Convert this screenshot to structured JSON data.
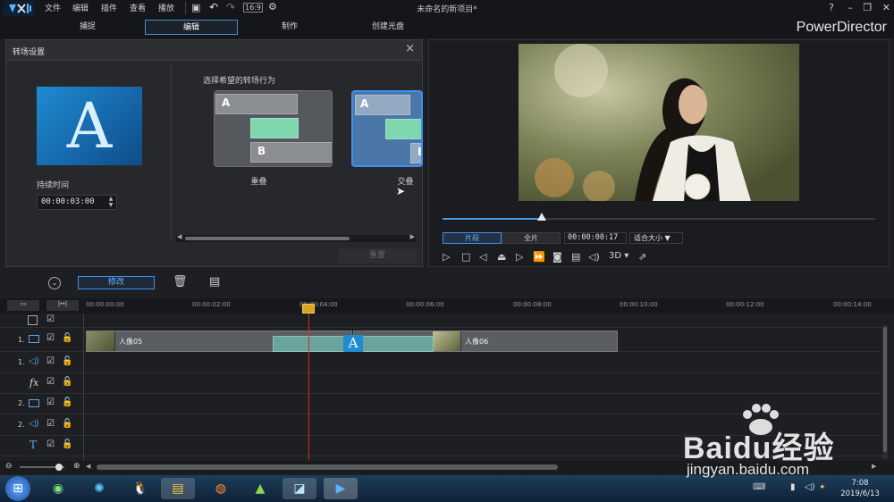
{
  "menu": {
    "items": [
      "文件",
      "编辑",
      "插件",
      "查看",
      "播放"
    ],
    "window_title": "未命名的新项目*",
    "help": "?",
    "brand": "PowerDirector"
  },
  "tabs": [
    "捕捉",
    "编辑",
    "制作",
    "创建光盘"
  ],
  "active_tab": "编辑",
  "dialog": {
    "title": "转场设置",
    "close": "×",
    "thumbnail_letter": "A",
    "duration_label": "持续时间",
    "duration_value": "00:00:03:00",
    "behavior_label": "选择希望的转场行为",
    "options": [
      {
        "name": "重叠",
        "a": "A",
        "b": "B"
      },
      {
        "name": "交叠",
        "a": "A",
        "b": "B"
      }
    ],
    "reset_label": "重置"
  },
  "viewer": {
    "mode_clip": "片段",
    "mode_movie": "全片",
    "timecode": "00:00:00:17",
    "fit_label": "适合大小",
    "controls": [
      "▷",
      "□",
      "◁|",
      "⏏",
      "|▷",
      "▷▷",
      "camera",
      "subtitle",
      "volume",
      "3D",
      "export"
    ],
    "three_d": "3D",
    "seek_fraction": 0.23
  },
  "timeline_toolbar": {
    "modify_label": "修改"
  },
  "timeline": {
    "ticks": [
      "00:00:00:00",
      "00:00:02:00",
      "00:00:04:00",
      "00:00:06:00",
      "00:00:08:00",
      "00:00:10:00",
      "00:00:12:00",
      "00:00:14:00"
    ],
    "tracks": [
      {
        "label": "1.",
        "type": "video-icon"
      },
      {
        "label": "1.",
        "type": "audio-icon"
      },
      {
        "label": "fx",
        "type": "fx-icon"
      },
      {
        "label": "2.",
        "type": "video-icon"
      },
      {
        "label": "2.",
        "type": "audio-icon"
      },
      {
        "label": "T",
        "type": "title-icon"
      }
    ],
    "clips": [
      {
        "name": "人像05"
      },
      {
        "name": "人像06"
      }
    ],
    "transition_letter": "A"
  },
  "taskbar": {
    "time": "7:08",
    "date": "2019/6/13"
  },
  "watermark": {
    "line1": "Baidu经验",
    "line2": "jingyan.baidu.com"
  }
}
